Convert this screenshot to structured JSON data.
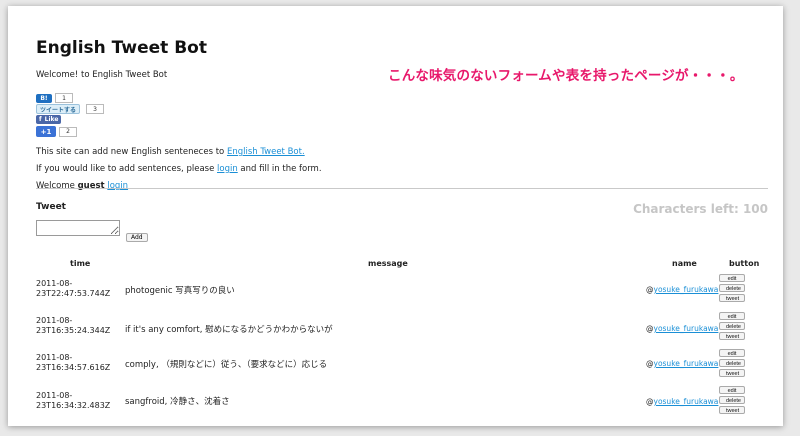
{
  "page": {
    "title": "English Tweet Bot",
    "welcome": "Welcome! to English Tweet Bot"
  },
  "annotation": "こんな味気のないフォームや表を持ったページが・・・。",
  "social": {
    "hatena_label": "B!",
    "hatena_count": "1",
    "tweet_label": "ツイートする",
    "tweet_count": "3",
    "like_label": "Like",
    "plusone_label": "+1",
    "plusone_count": "2"
  },
  "info": {
    "line1_prefix": "This site can add new English senteneces to ",
    "line1_link": "English Tweet Bot.",
    "line2_prefix": "If you would like to add sentences, please ",
    "line2_link": "login",
    "line2_suffix": " and fill in the form.",
    "line3_prefix": "Welcome ",
    "line3_user": "guest",
    "line3_link": "login"
  },
  "tweet_form": {
    "title": "Tweet",
    "chars_left": "Characters left: 100",
    "add_label": "Add"
  },
  "table": {
    "headers": [
      "time",
      "message",
      "name",
      "button"
    ],
    "buttons": [
      "edit",
      "delete",
      "tweet"
    ],
    "rows": [
      {
        "time_a": "2011-08-",
        "time_b": "23T22:47:53.744Z",
        "message": "photogenic 写真写りの良い",
        "at": "@",
        "user": "yosuke_furukawa"
      },
      {
        "time_a": "2011-08-",
        "time_b": "23T16:35:24.344Z",
        "message": "if it's any comfort, 慰めになるかどうかわからないが",
        "at": "@",
        "user": "yosuke_furukawa"
      },
      {
        "time_a": "2011-08-",
        "time_b": "23T16:34:57.616Z",
        "message": "comply, （規則などに）従う、（要求などに）応じる",
        "at": "@",
        "user": "yosuke_furukawa"
      },
      {
        "time_a": "2011-08-",
        "time_b": "23T16:34:32.483Z",
        "message": "sangfroid, 冷静さ、沈着さ",
        "at": "@",
        "user": "yosuke_furukawa"
      }
    ]
  }
}
